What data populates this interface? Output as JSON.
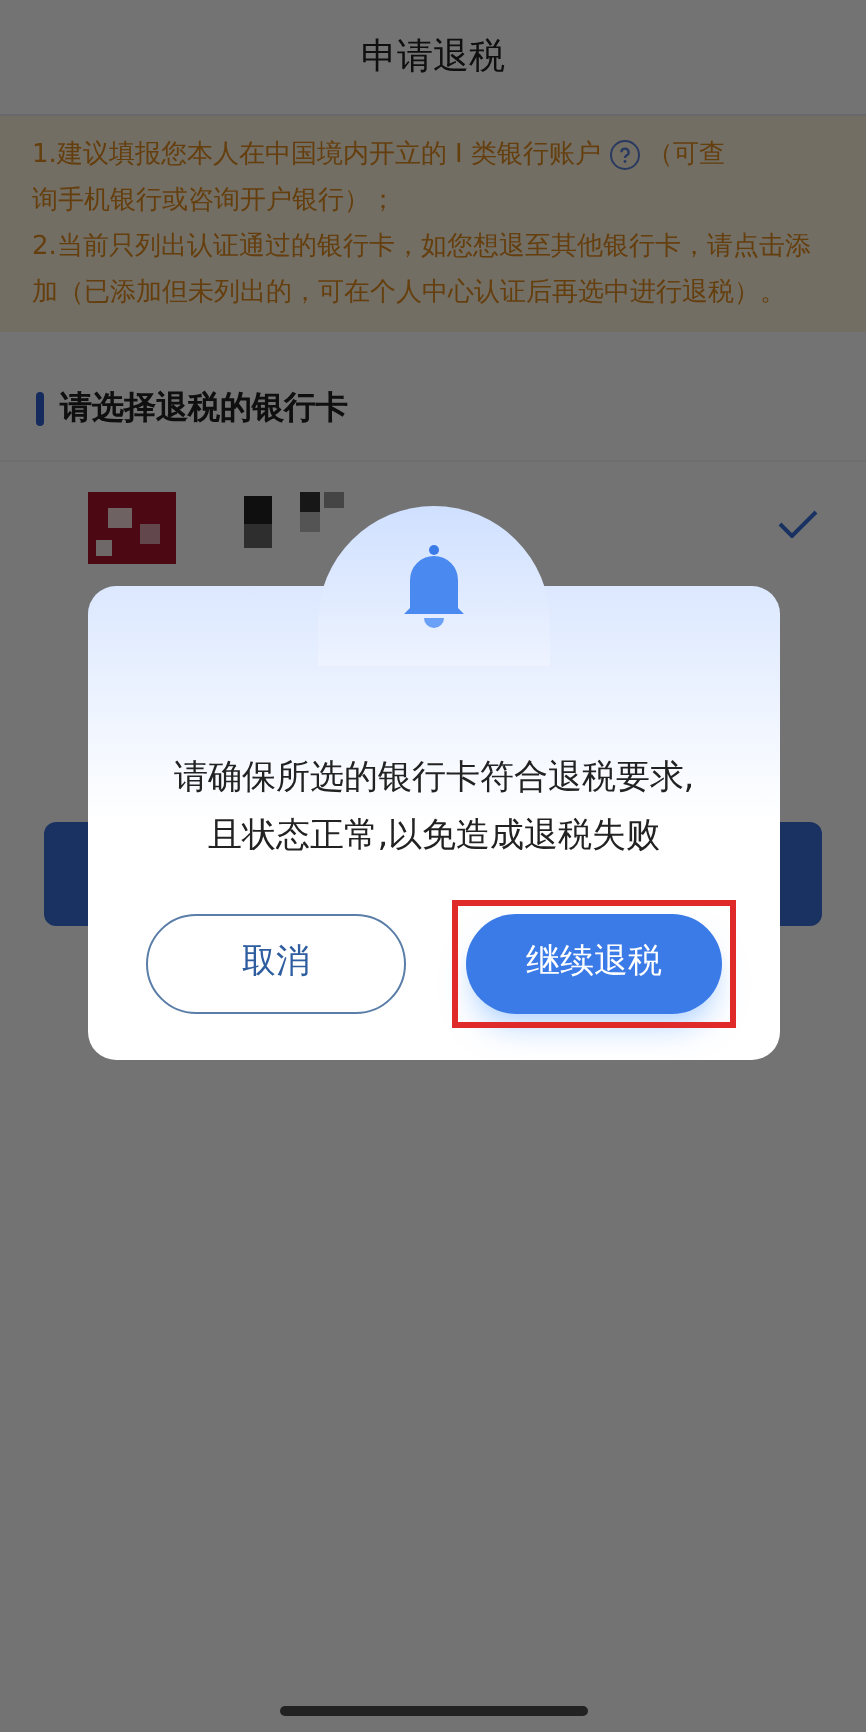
{
  "header": {
    "title": "申请退税"
  },
  "notice": {
    "item_1_before": "1.建议填报您本人在中国境内开立的 I 类银行账户",
    "item_1_after": "（可查",
    "item_1_cont": "询手机银行或咨询开户银行）；",
    "item_2": "2.当前只列出认证通过的银行卡，如您想退至其他银行卡，请点击添加（已添加但未列出的，可在个人中心认证后再选中进行退税）。"
  },
  "section": {
    "title": "请选择退税的银行卡"
  },
  "bank_cards": [
    {
      "kind": "redacted",
      "selected": true
    }
  ],
  "dialog": {
    "message": "请确保所选的银行卡符合退税要求,\n且状态正常,以免造成退税失败",
    "buttons": [
      {
        "kind": "secondary",
        "label": "取消",
        "highlighted": false
      },
      {
        "kind": "primary",
        "label": "继续退税",
        "highlighted": true
      }
    ]
  }
}
